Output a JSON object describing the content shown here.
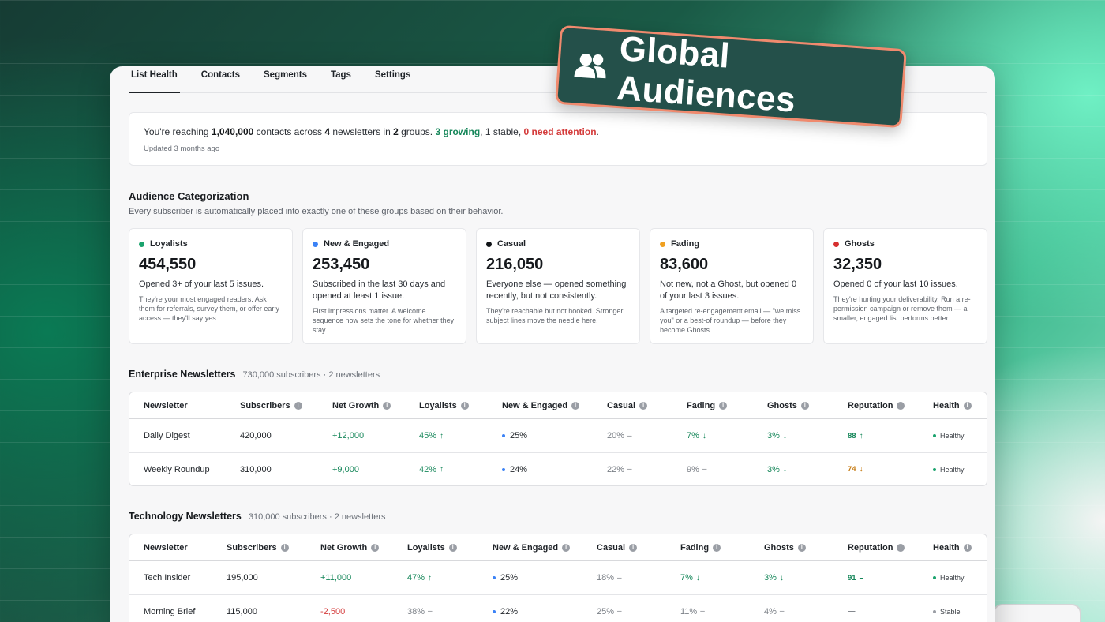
{
  "tabs": [
    "List Health",
    "Contacts",
    "Segments",
    "Tags",
    "Settings"
  ],
  "summary": {
    "prefix": "You're reaching ",
    "contacts": "1,040,000",
    "mid1": " contacts across ",
    "newsletters": "4",
    "mid2": " newsletters in ",
    "groups": "2",
    "mid3": " groups. ",
    "growing": "3 growing",
    "mid4": ", 1 stable, ",
    "attention": "0 need attention",
    "suffix": ".",
    "updated": "Updated 3 months ago"
  },
  "categorization": {
    "title": "Audience Categorization",
    "subtitle": "Every subscriber is automatically placed into exactly one of these groups based on their behavior.",
    "cards": [
      {
        "name": "Loyalists",
        "color": "#1aa36d",
        "value": "454,550",
        "desc": "Opened 3+ of your last 5 issues.",
        "note": "They're your most engaged readers. Ask them for referrals, survey them, or offer early access — they'll say yes."
      },
      {
        "name": "New & Engaged",
        "color": "#3b82f6",
        "value": "253,450",
        "desc": "Subscribed in the last 30 days and opened at least 1 issue.",
        "note": "First impressions matter. A welcome sequence now sets the tone for whether they stay."
      },
      {
        "name": "Casual",
        "color": "#111418",
        "value": "216,050",
        "desc": "Everyone else — opened something recently, but not consistently.",
        "note": "They're reachable but not hooked. Stronger subject lines move the needle here."
      },
      {
        "name": "Fading",
        "color": "#f0a020",
        "value": "83,600",
        "desc": "Not new, not a Ghost, but opened 0 of your last 3 issues.",
        "note": "A targeted re-engagement email — \"we miss you\" or a best-of roundup — before they become Ghosts."
      },
      {
        "name": "Ghosts",
        "color": "#d62f2f",
        "value": "32,350",
        "desc": "Opened 0 of your last 10 issues.",
        "note": "They're hurting your deliverability. Run a re-permission campaign or remove them — a smaller, engaged list performs better."
      }
    ]
  },
  "sections": [
    {
      "title": "Enterprise Newsletters",
      "meta": "730,000 subscribers · 2 newsletters",
      "columns": [
        "Newsletter",
        "Subscribers",
        "Net Growth",
        "Loyalists",
        "New & Engaged",
        "Casual",
        "Fading",
        "Ghosts",
        "Reputation",
        "Health"
      ],
      "rows": [
        {
          "name": "Daily Digest",
          "subs": "420,000",
          "growth": "+12,000",
          "loyal": "45%",
          "new": "25%",
          "casual": "20%",
          "fading": "7%",
          "ghosts": "3%",
          "rep": "88",
          "health": "Healthy"
        },
        {
          "name": "Weekly Roundup",
          "subs": "310,000",
          "growth": "+9,000",
          "loyal": "42%",
          "new": "24%",
          "casual": "22%",
          "fading": "9%",
          "ghosts": "3%",
          "rep": "74",
          "health": "Healthy"
        }
      ]
    },
    {
      "title": "Technology Newsletters",
      "meta": "310,000 subscribers · 2 newsletters",
      "columns": [
        "Newsletter",
        "Subscribers",
        "Net Growth",
        "Loyalists",
        "New & Engaged",
        "Casual",
        "Fading",
        "Ghosts",
        "Reputation",
        "Health"
      ],
      "rows": [
        {
          "name": "Tech Insider",
          "subs": "195,000",
          "growth": "+11,000",
          "loyal": "47%",
          "new": "25%",
          "casual": "18%",
          "fading": "7%",
          "ghosts": "3%",
          "rep": "91",
          "health": "Healthy"
        },
        {
          "name": "Morning Brief",
          "subs": "115,000",
          "growth": "-2,500",
          "loyal": "38%",
          "new": "22%",
          "casual": "25%",
          "fading": "11%",
          "ghosts": "4%",
          "rep": "—",
          "health": "Stable"
        }
      ]
    }
  ],
  "badge": {
    "text": "Global Audiences",
    "icon": "users-icon"
  },
  "colors": {
    "accent": "#16875a",
    "danger": "#d43b3b",
    "badge_bg": "#24504a",
    "badge_border": "#f08a6e"
  }
}
